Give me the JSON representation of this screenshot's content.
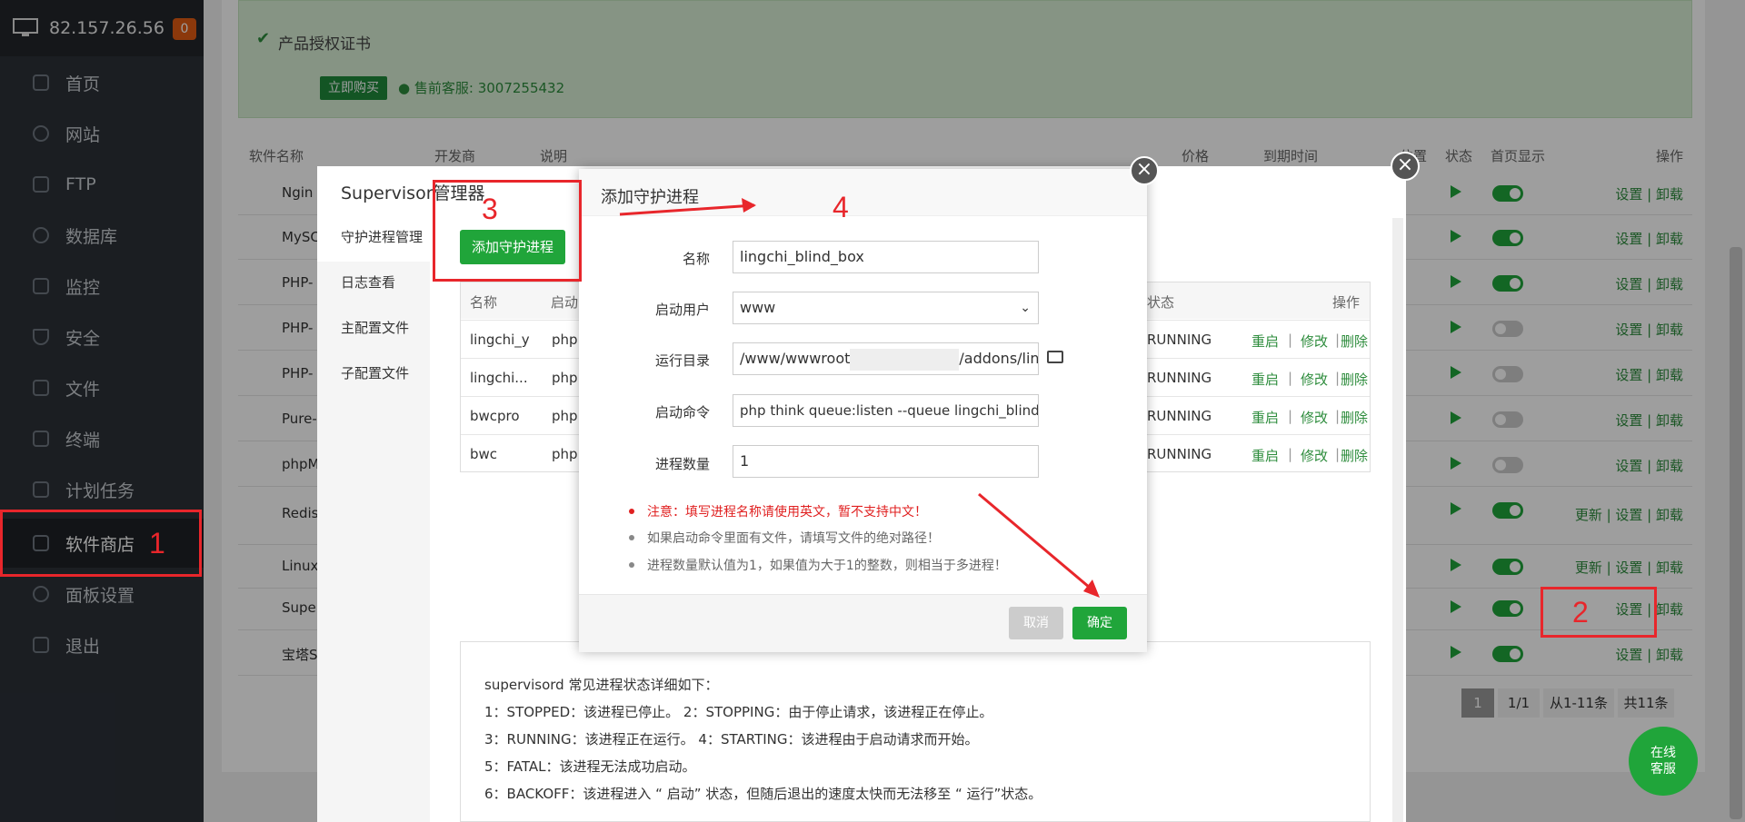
{
  "sidebar": {
    "ip": "82.157.26.56",
    "badge": "0",
    "items": [
      "首页",
      "网站",
      "FTP",
      "数据库",
      "监控",
      "安全",
      "文件",
      "终端",
      "计划任务",
      "软件商店",
      "面板设置",
      "退出"
    ]
  },
  "banner": {
    "cert": "产品授权证书",
    "buy": "立即购买",
    "contact": "售前客服: 3007255432"
  },
  "table": {
    "headers": [
      "软件名称",
      "开发商",
      "说明",
      "价格",
      "到期时间",
      "位置",
      "状态",
      "首页显示",
      "操作"
    ],
    "rows": [
      {
        "name": "Ngin",
        "ops": "设置 | 卸载"
      },
      {
        "name": "MySC",
        "ops": "设置 | 卸载"
      },
      {
        "name": "PHP-",
        "ops": "设置 | 卸载"
      },
      {
        "name": "PHP-",
        "ops": "设置 | 卸载"
      },
      {
        "name": "PHP-",
        "ops": "设置 | 卸载"
      },
      {
        "name": "Pure-",
        "ops": "设置 | 卸载"
      },
      {
        "name": "phpM",
        "ops": "设置 | 卸载"
      },
      {
        "name": "Redis",
        "ops": "更新 | 设置 | 卸载"
      },
      {
        "name": "Linux",
        "ops": "更新 | 设置 | 卸载"
      },
      {
        "name": "Supe",
        "ops": "设置 | 卸载"
      },
      {
        "name": "宝塔S",
        "ops": "设置 | 卸载"
      }
    ]
  },
  "supervisor": {
    "title": "Supervisor管理器",
    "menu": [
      "守护进程管理",
      "日志查看",
      "主配置文件",
      "子配置文件"
    ],
    "add_button": "添加守护进程",
    "col_name": "名称",
    "col_start": "启动",
    "col_status": "状态",
    "col_ops": "操作",
    "rows": [
      {
        "name": "lingchi_y",
        "cmd": "php",
        "status": "RUNNING"
      },
      {
        "name": "lingchi...",
        "cmd": "php",
        "status": "RUNNING"
      },
      {
        "name": "bwcpro",
        "cmd": "php",
        "status": "RUNNING"
      },
      {
        "name": "bwc",
        "cmd": "php",
        "status": "RUNNING"
      }
    ],
    "row_ops": [
      "重启",
      "修改",
      "删除"
    ],
    "notes": [
      "supervisord 常见进程状态详细如下：",
      "1：STOPPED：该进程已停止。      2：STOPPING：由于停止请求，该进程正在停止。",
      "3：RUNNING：该进程正在运行。  4：STARTING：该进程由于启动请求而开始。",
      "5：FATAL：该进程无法成功启动。",
      "6：BACKOFF：该进程进入 “ 启动” 状态，但随后退出的速度太快而无法移至 “ 运行”状态。"
    ]
  },
  "pager": {
    "page": "1",
    "total_pages": "1/1",
    "range": "从1-11条",
    "count": "共11条"
  },
  "dialog": {
    "title": "添加守护进程",
    "labels": [
      "名称",
      "启动用户",
      "运行目录",
      "启动命令",
      "进程数量"
    ],
    "name_value": "lingchi_blind_box",
    "user_value": "www",
    "dir_prefix": "/www/wwwroot",
    "dir_suffix": "/addons/ling",
    "cmd_value": "php think queue:listen --queue lingchi_blind_",
    "count_value": "1",
    "tips": [
      "注意：填写进程名称请使用英文，暂不支持中文！",
      "如果启动命令里面有文件，请填写文件的绝对路径！",
      "进程数量默认值为1，如果值为大于1的整数，则相当于多进程！"
    ],
    "cancel": "取消",
    "ok": "确定"
  },
  "annotations": [
    "1",
    "2",
    "3",
    "4"
  ],
  "chat": "在线客服",
  "colors": {
    "accent": "#20a53a",
    "annotation": "#e8262b",
    "sidebar": "#2c3138"
  }
}
